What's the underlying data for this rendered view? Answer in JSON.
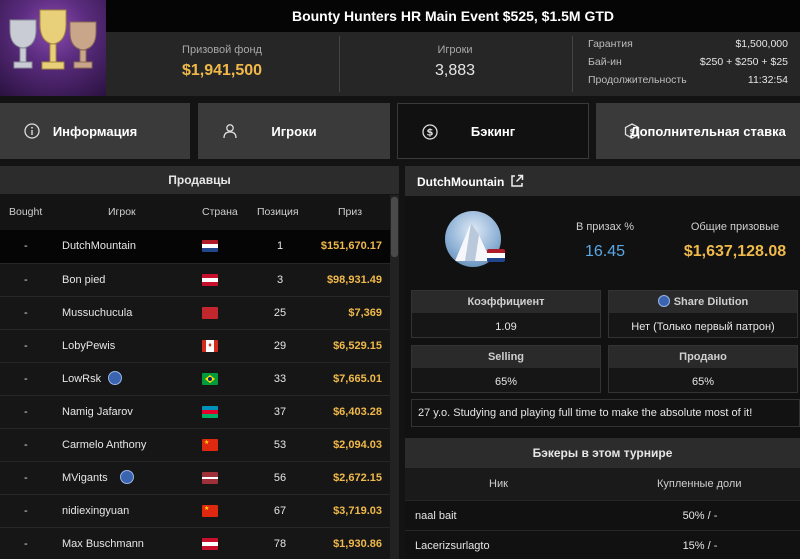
{
  "header": {
    "title": "Bounty Hunters HR Main Event $525, $1.5M GTD",
    "prize_pool_label": "Призовой фонд",
    "prize_pool_value": "$1,941,500",
    "players_label": "Игроки",
    "players_value": "3,883",
    "guarantee_label": "Гарантия",
    "guarantee_value": "$1,500,000",
    "buyin_label": "Бай-ин",
    "buyin_value": "$250 + $250 + $25",
    "duration_label": "Продолжительность",
    "duration_value": "11:32:54"
  },
  "tabs": [
    {
      "label": "Информация",
      "icon": "info-icon"
    },
    {
      "label": "Игроки",
      "icon": "user-icon"
    },
    {
      "label": "Бэкинг",
      "icon": "dollar-coin-icon"
    },
    {
      "label": "Дополнительная ставка",
      "icon": "stake-icon"
    }
  ],
  "sellers": {
    "title": "Продавцы",
    "columns": [
      "Bought",
      "Игрок",
      "Страна",
      "Позиция",
      "Приз"
    ],
    "rows": [
      {
        "bought": "-",
        "player": "DutchMountain",
        "country": "NL",
        "position": "1",
        "prize": "$151,670.17",
        "badge": false
      },
      {
        "bought": "-",
        "player": "Bon pied",
        "country": "AT",
        "position": "3",
        "prize": "$98,931.49",
        "badge": false
      },
      {
        "bought": "-",
        "player": "Mussuchucula",
        "country": "MA",
        "position": "25",
        "prize": "$7,369",
        "badge": false
      },
      {
        "bought": "-",
        "player": "LobyPewis",
        "country": "CA",
        "position": "29",
        "prize": "$6,529.15",
        "badge": false
      },
      {
        "bought": "-",
        "player": "LowRsk",
        "country": "BR",
        "position": "33",
        "prize": "$7,665.01",
        "badge": true
      },
      {
        "bought": "-",
        "player": "Namig Jafarov",
        "country": "AZ",
        "position": "37",
        "prize": "$6,403.28",
        "badge": false
      },
      {
        "bought": "-",
        "player": "Carmelo Anthony",
        "country": "CN",
        "position": "53",
        "prize": "$2,094.03",
        "badge": false
      },
      {
        "bought": "-",
        "player": "MVigants",
        "country": "LV",
        "position": "56",
        "prize": "$2,672.15",
        "badge": true
      },
      {
        "bought": "-",
        "player": "nidiexingyuan",
        "country": "CN",
        "position": "67",
        "prize": "$3,719.03",
        "badge": false
      },
      {
        "bought": "-",
        "player": "Max Buschmann",
        "country": "AT",
        "position": "78",
        "prize": "$1,930.86",
        "badge": false
      }
    ]
  },
  "profile": {
    "name": "DutchMountain",
    "in_prizes_label": "В призах %",
    "in_prizes_value": "16.45",
    "total_prizes_label": "Общие призовые",
    "total_prizes_value": "$1,637,128.08",
    "coef_label": "Коэффициент",
    "coef_value": "1.09",
    "dilution_label": "Share Dilution",
    "dilution_value": "Нет (Только первый патрон)",
    "selling_label": "Selling",
    "selling_value": "65%",
    "sold_label": "Продано",
    "sold_value": "65%",
    "description": "27 y.o. Studying and playing full time to make the absolute most of it!"
  },
  "backers": {
    "title": "Бэкеры в этом турнире",
    "col_nick": "Ник",
    "col_shares": "Купленные доли",
    "rows": [
      {
        "nick": "naal bait",
        "shares": "50% / -"
      },
      {
        "nick": "Lacerizsurlagto",
        "shares": "15% / -"
      }
    ]
  },
  "colors": {
    "accent_gold": "#f0b94a",
    "accent_blue": "#5aa9e6"
  }
}
